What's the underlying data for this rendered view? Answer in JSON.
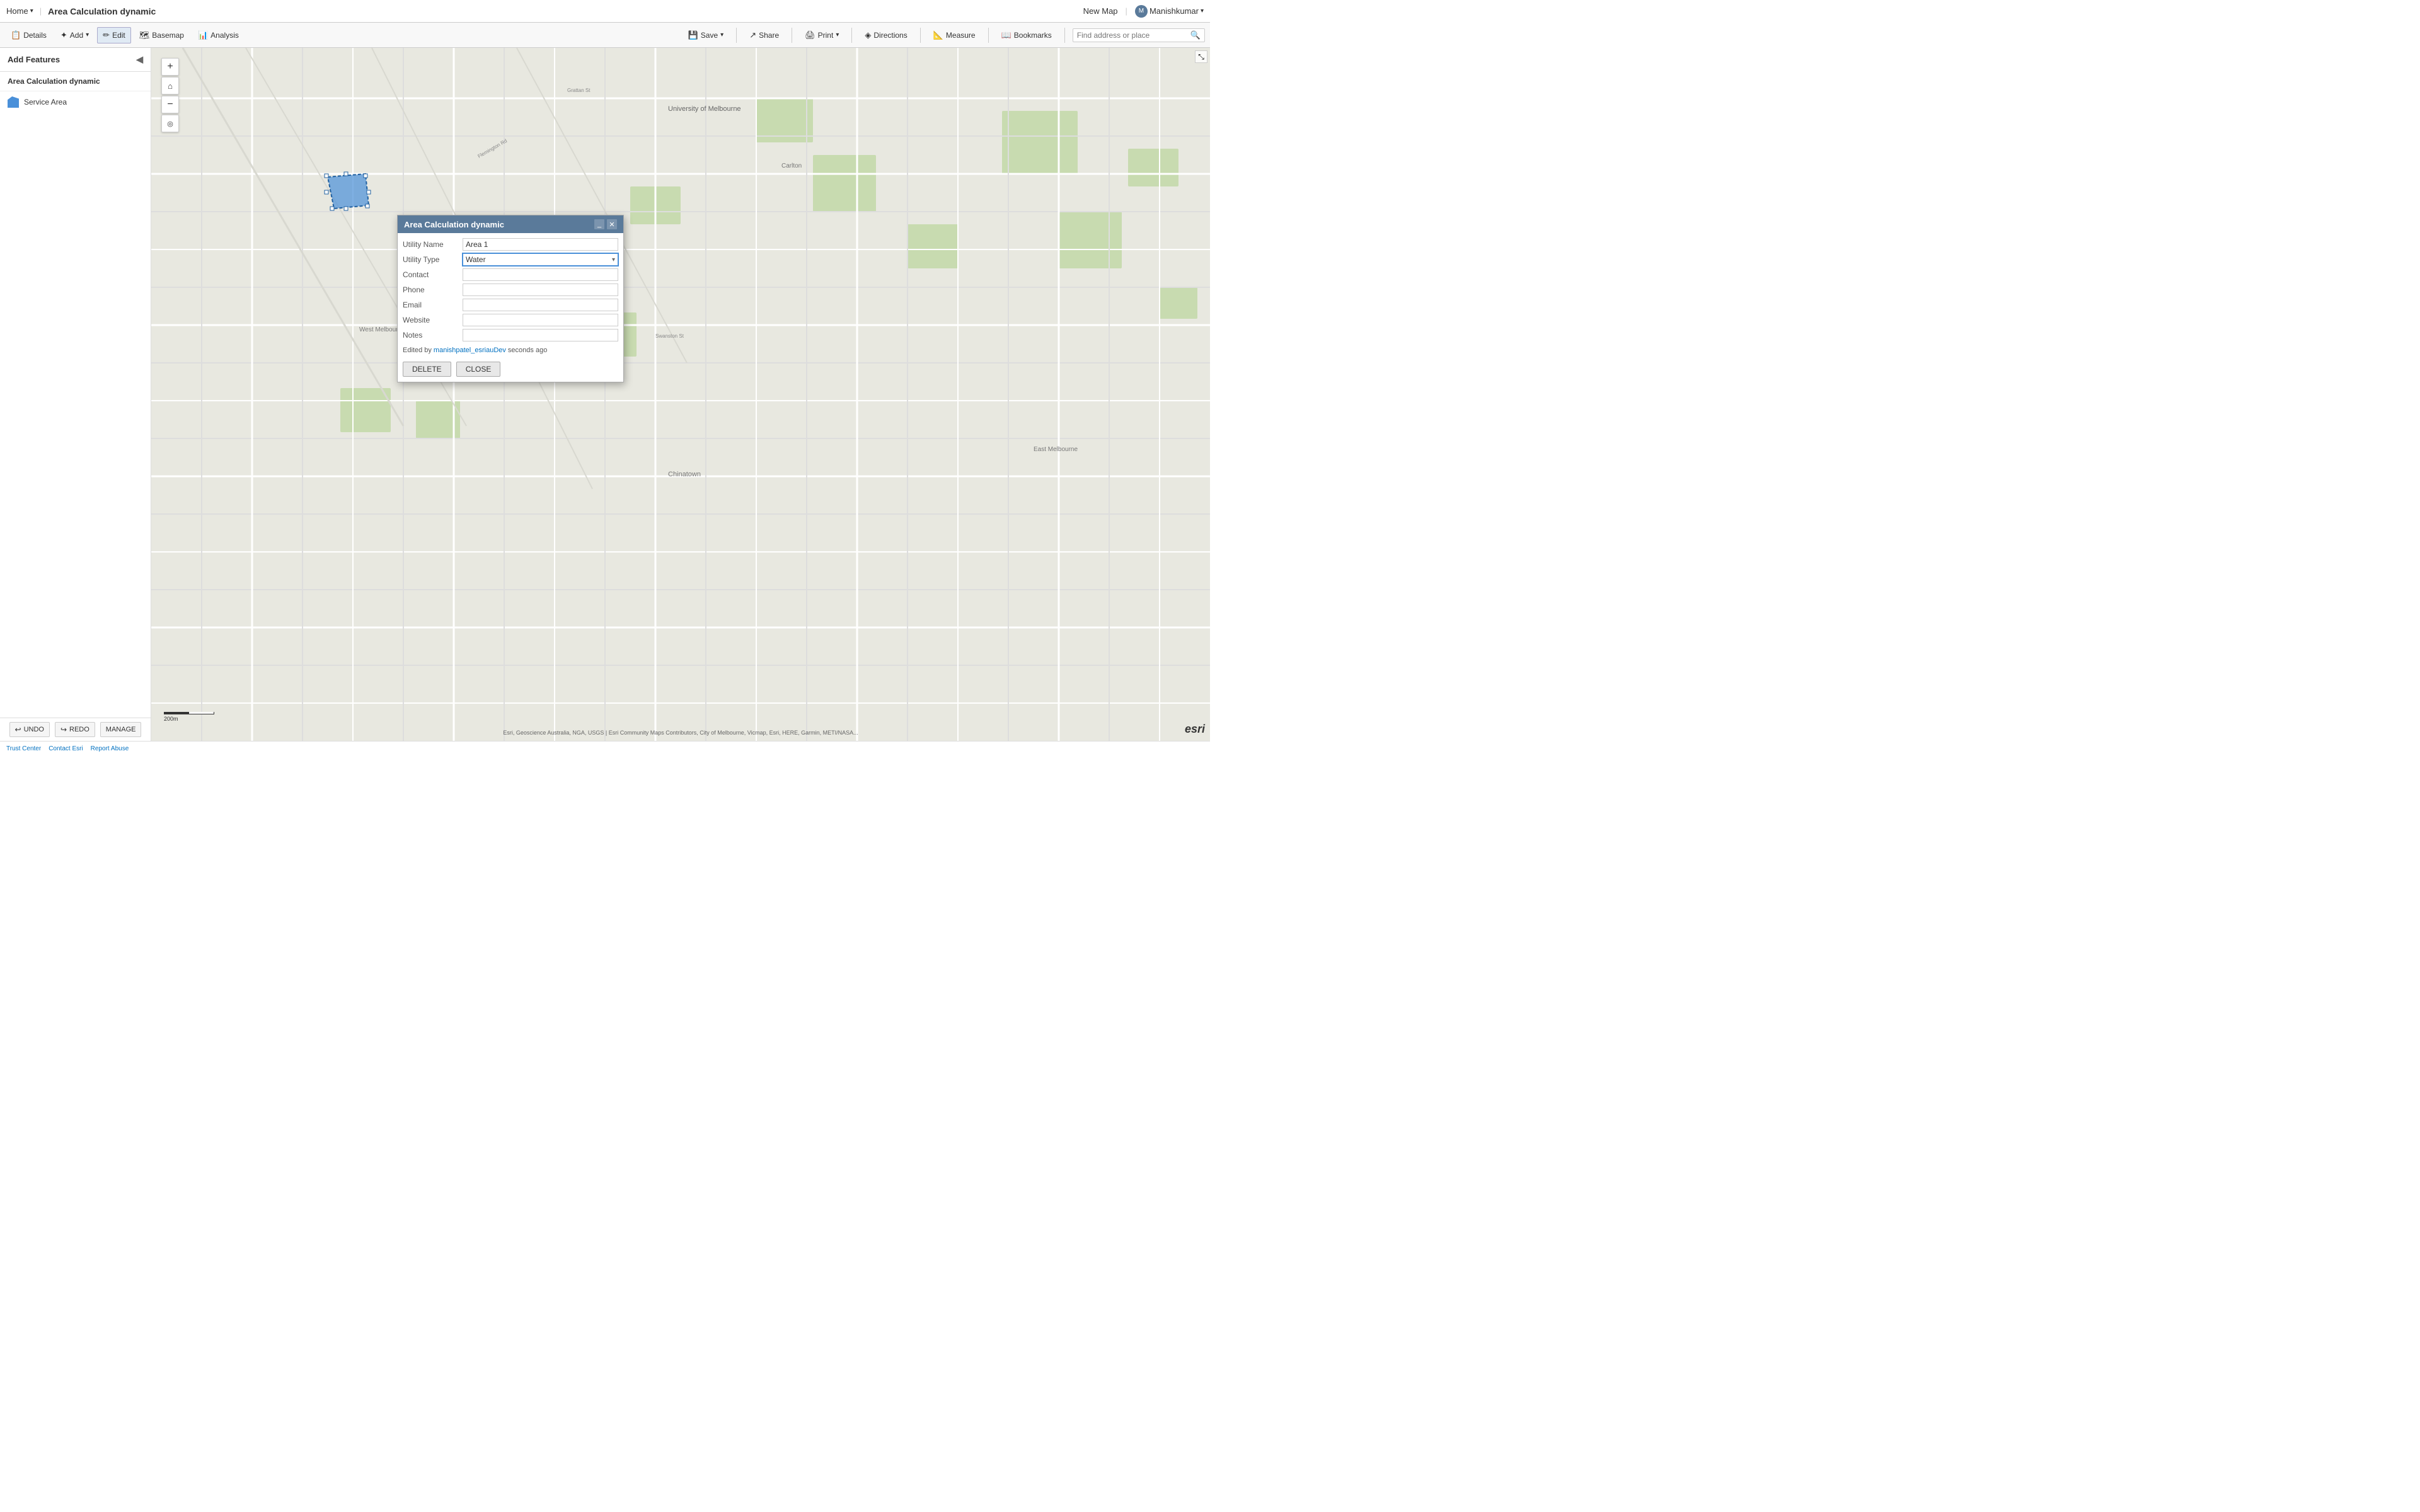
{
  "topnav": {
    "home_label": "Home",
    "home_arrow": "▾",
    "app_title": "Area Calculation dynamic",
    "new_map": "New Map",
    "user": "Manishkumar",
    "user_arrow": "▾"
  },
  "toolbar": {
    "details_label": "Details",
    "add_label": "Add",
    "add_arrow": "▾",
    "edit_label": "Edit",
    "basemap_label": "Basemap",
    "analysis_label": "Analysis",
    "save_label": "Save",
    "save_arrow": "▾",
    "share_label": "Share",
    "print_label": "Print",
    "print_arrow": "▾",
    "directions_label": "Directions",
    "measure_label": "Measure",
    "bookmarks_label": "Bookmarks",
    "search_placeholder": "Find address or place"
  },
  "sidebar": {
    "header": "Add Features",
    "layer_title": "Area Calculation dynamic",
    "layer_item": "Service Area"
  },
  "sidebar_bottom": {
    "undo_label": "UNDO",
    "redo_label": "REDO",
    "manage_label": "MANAGE"
  },
  "footer": {
    "trust_center": "Trust Center",
    "contact_esri": "Contact Esri",
    "report_abuse": "Report Abuse"
  },
  "popup": {
    "title": "Area Calculation dynamic",
    "fields": [
      {
        "label": "Utility Name",
        "value": "Area 1",
        "type": "input"
      },
      {
        "label": "Utility Type",
        "value": "Water",
        "type": "select"
      },
      {
        "label": "Contact",
        "value": "",
        "type": "input"
      },
      {
        "label": "Phone",
        "value": "",
        "type": "input"
      },
      {
        "label": "Email",
        "value": "",
        "type": "input"
      },
      {
        "label": "Website",
        "value": "",
        "type": "input"
      },
      {
        "label": "Notes",
        "value": "",
        "type": "input"
      }
    ],
    "edited_prefix": "Edited by ",
    "edited_user": "manishpatel_esriauDev",
    "edited_suffix": " seconds ago",
    "delete_btn": "DELETE",
    "close_btn": "CLOSE"
  },
  "map": {
    "scale_label": "200m",
    "attribution": "Esri, Geoscience Australia, NGA, USGS | Esri Community Maps Contributors, City of Melbourne, Vicmap, Esri, HERE, Garmin, METI/NASA...",
    "esri_logo": "esri"
  },
  "icons": {
    "plus": "+",
    "minus": "−",
    "home": "⌂",
    "location": "◎",
    "search": "🔍",
    "details": "📋",
    "add_feature": "✦",
    "edit": "✏",
    "basemap": "🗺",
    "analysis": "📊",
    "save": "💾",
    "share": "↗",
    "print": "🖨",
    "directions": "◈",
    "measure": "📐",
    "bookmarks": "📖",
    "collapse": "◀",
    "undo": "↩",
    "redo": "↪",
    "resize": "⤡",
    "close_x": "✕"
  }
}
